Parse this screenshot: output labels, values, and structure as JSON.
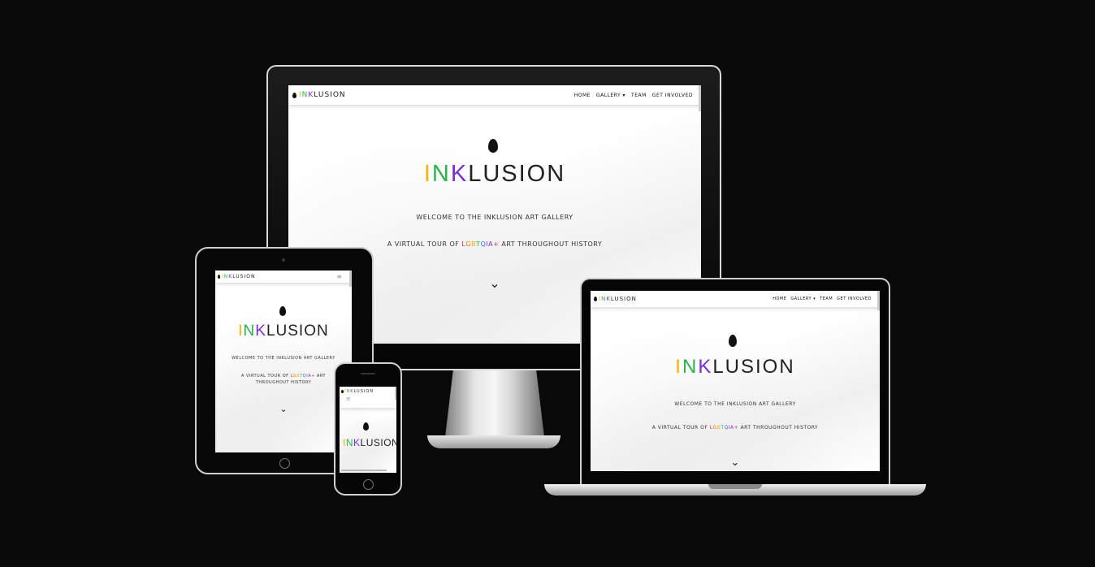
{
  "site": {
    "logo_letters": [
      "I",
      "N",
      "K",
      "LUSION"
    ],
    "nav": {
      "home": "HOME",
      "gallery": "GALLERY",
      "team": "TEAM",
      "get_involved": "GET INVOLVED",
      "caret": "▾"
    },
    "hero_letters": [
      "I",
      "N",
      "K",
      "LUSION"
    ],
    "welcome": "WELCOME TO THE INKLUSION ART GALLERY",
    "tour_prefix": "A VIRTUAL TOUR OF ",
    "lgbt": [
      "L",
      "G",
      "B",
      "T",
      "Q",
      "I",
      "A",
      "+"
    ],
    "tour_suffix": " ART THROUGHOUT HISTORY",
    "tour_line2": "ART THROUGHOUT HISTORY",
    "chevron": "⌄",
    "hamburger": "≡"
  },
  "colors": {
    "background": "#0a0909",
    "I": "#f2b200",
    "N": "#2bb24c",
    "K": "#7a2fd0",
    "text": "#222222"
  }
}
